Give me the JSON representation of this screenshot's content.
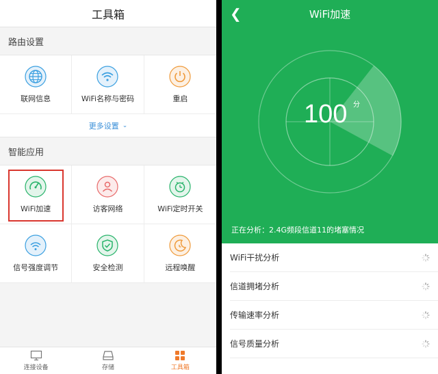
{
  "left": {
    "title": "工具箱",
    "router_section": "路由设置",
    "router_items": [
      {
        "label": "联网信息",
        "icon": "globe-icon",
        "color": "#3a9fe0"
      },
      {
        "label": "WiFi名称与密码",
        "icon": "wifi-icon",
        "color": "#3a9fe0"
      },
      {
        "label": "重启",
        "icon": "power-icon",
        "color": "#ef9a3a"
      }
    ],
    "more_settings": "更多设置",
    "apps_section": "智能应用",
    "app_items": [
      {
        "label": "WiFi加速",
        "icon": "speedometer-icon",
        "color": "#27b36a"
      },
      {
        "label": "访客网络",
        "icon": "guest-icon",
        "color": "#e86a6a"
      },
      {
        "label": "WiFi定时开关",
        "icon": "wifi-timer-icon",
        "color": "#27b36a"
      },
      {
        "label": "信号强度调节",
        "icon": "signal-strength-icon",
        "color": "#3a9fe0"
      },
      {
        "label": "安全检测",
        "icon": "shield-check-icon",
        "color": "#27b36a"
      },
      {
        "label": "远程唤醒",
        "icon": "moon-clock-icon",
        "color": "#ef9a3a"
      }
    ],
    "tabs": [
      {
        "label": "连接设备",
        "icon": "monitor-icon"
      },
      {
        "label": "存储",
        "icon": "storage-icon"
      },
      {
        "label": "工具箱",
        "icon": "toolbox-icon",
        "active": true
      }
    ],
    "accent": "#ef7a2b"
  },
  "right": {
    "title": "WiFi加速",
    "score": "100",
    "score_unit": "分",
    "status": "正在分析：2.4G频段信道11的堵塞情况",
    "items": [
      {
        "label": "WiFi干扰分析"
      },
      {
        "label": "信道拥堵分析"
      },
      {
        "label": "传输速率分析"
      },
      {
        "label": "信号质量分析"
      }
    ],
    "bg_color": "#1fae56"
  }
}
